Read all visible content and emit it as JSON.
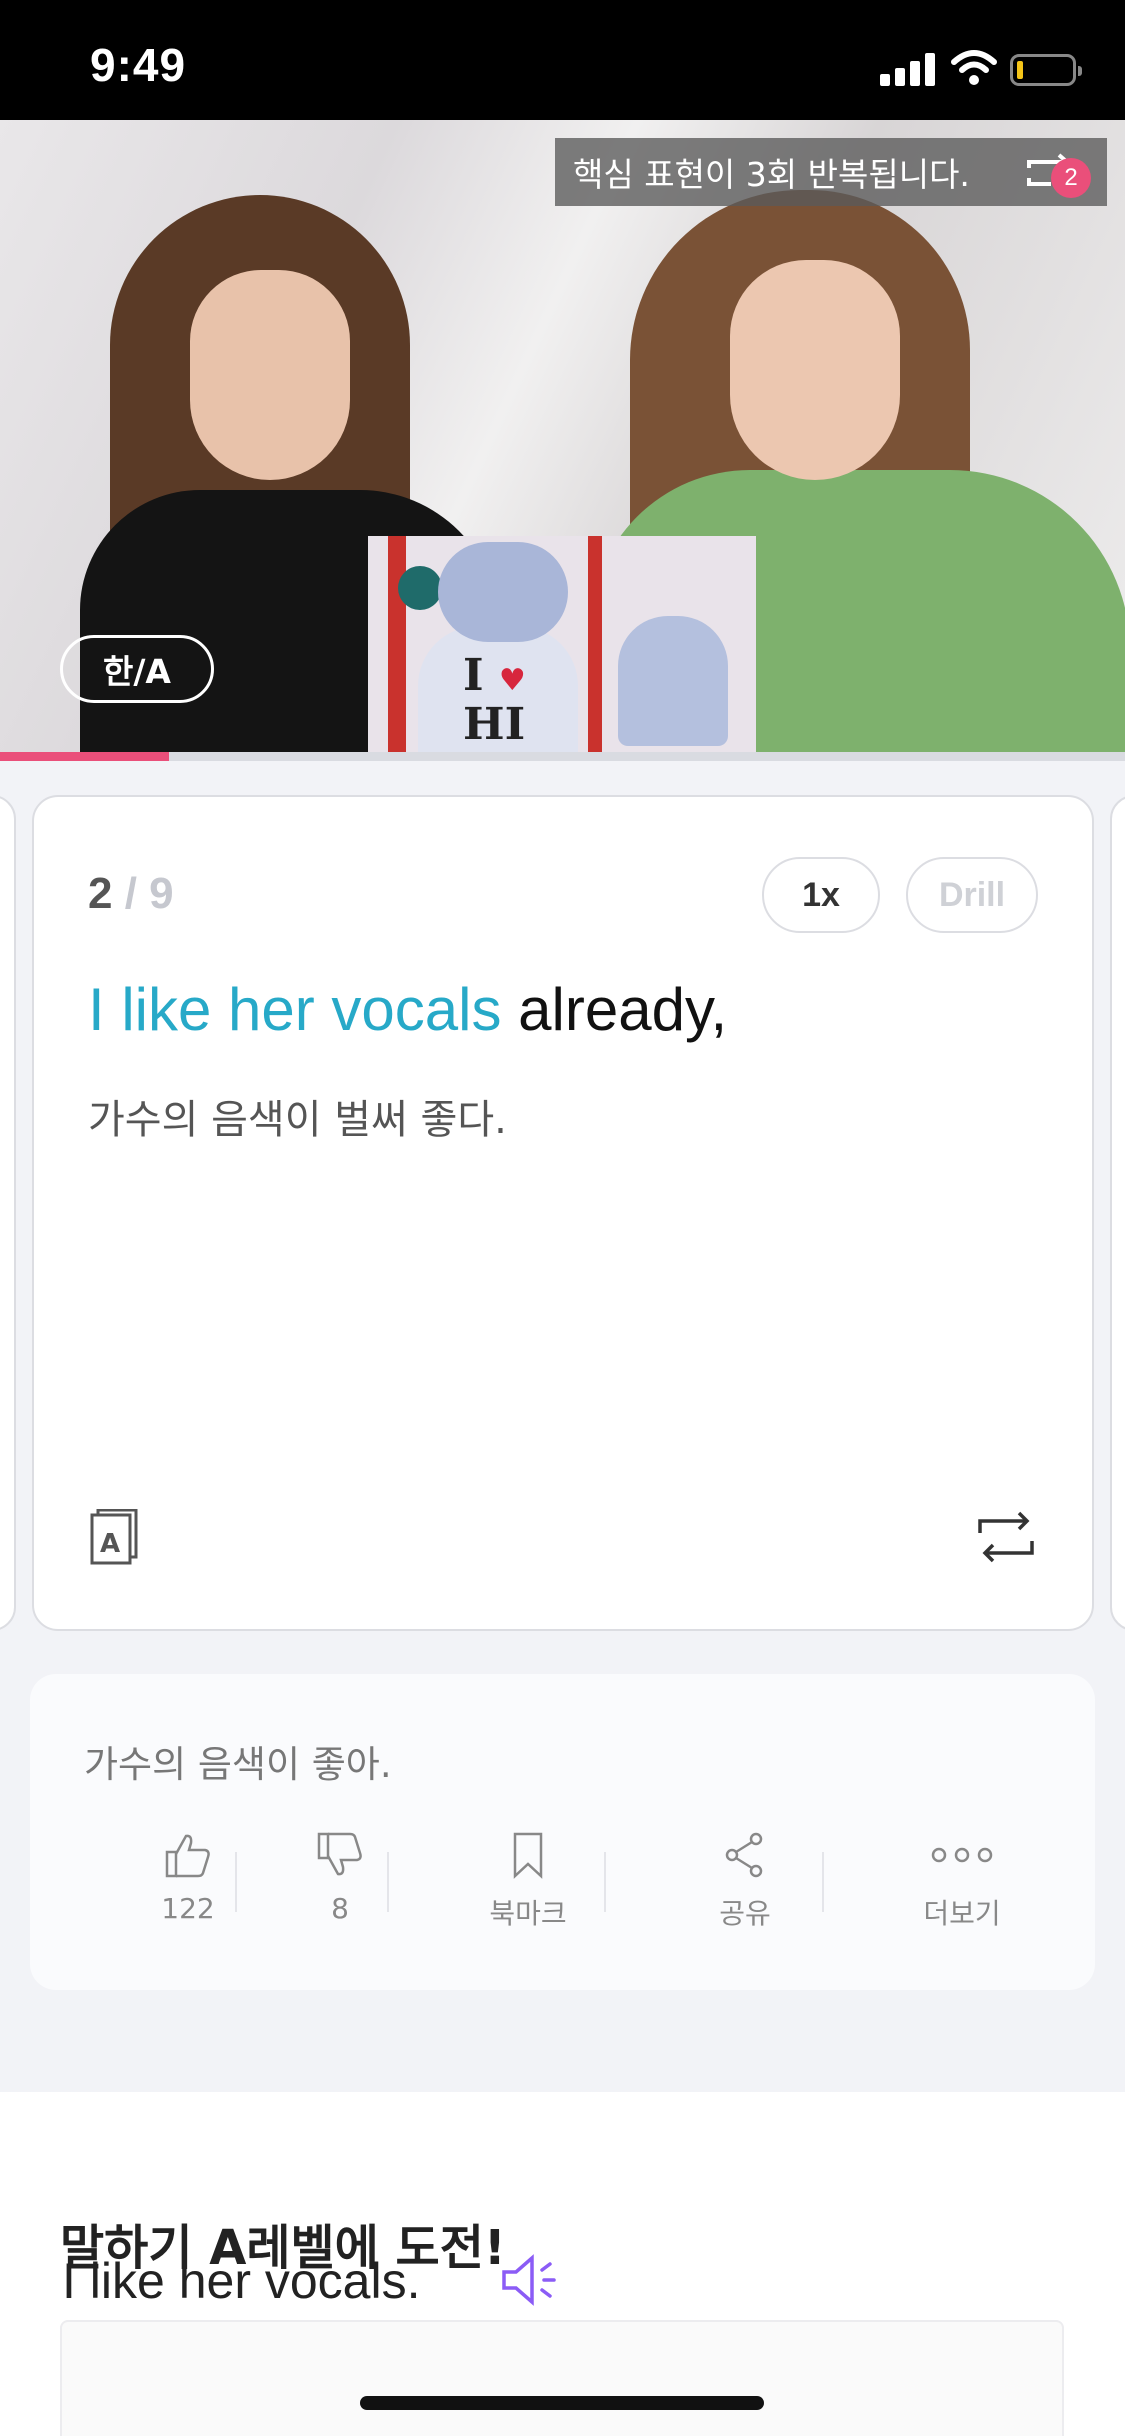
{
  "status_bar": {
    "time": "9:49"
  },
  "video": {
    "banner_text": "핵심 표현이 3회 반복됩니다.",
    "repeat_count": "2",
    "lang_toggle": "한/A",
    "progress": 0.15
  },
  "card": {
    "counter_current": "2",
    "counter_separator": " / ",
    "counter_total": "9",
    "speed_label": "1x",
    "drill_label": "Drill",
    "sentence_highlight": "I like her vocals",
    "sentence_rest": " already,",
    "translation": "가수의 음색이 벌써 좋다."
  },
  "panel": {
    "alt_translation": "가수의 음색이 좋아.",
    "actions": [
      {
        "icon": "thumbs-up-icon",
        "label": "122"
      },
      {
        "icon": "thumbs-down-icon",
        "label": "8"
      },
      {
        "icon": "bookmark-icon",
        "label": "북마크"
      },
      {
        "icon": "share-icon",
        "label": "공유"
      },
      {
        "icon": "more-icon",
        "label": "더보기"
      }
    ]
  },
  "speaking": {
    "title": "말하기 A레벨에 도전!",
    "sentence": "I like her vocals."
  },
  "colors": {
    "accent_blue": "#27a9c8",
    "accent_pink": "#ea4f7a",
    "speaker_purple": "#8b5cf6"
  }
}
